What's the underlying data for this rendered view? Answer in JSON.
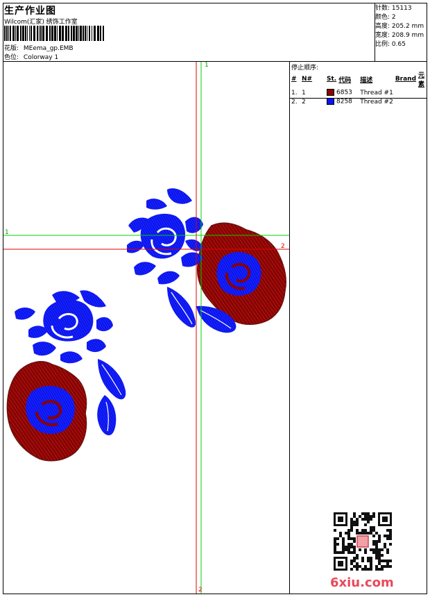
{
  "header": {
    "title": "生产作业图",
    "studio": "Wilcom(汇家) 绣饰工作室",
    "design_label": "花版:",
    "design_value": "MEema_gp.EMB",
    "colorway_label": "色位:",
    "colorway_value": "Colorway 1"
  },
  "stats": [
    {
      "label": "针数:",
      "value": "15113"
    },
    {
      "label": "颜色:",
      "value": "2"
    },
    {
      "label": "高度:",
      "value": "205.2 mm"
    },
    {
      "label": "宽度:",
      "value": "208.9 mm"
    },
    {
      "label": "比例:",
      "value": "0.65"
    }
  ],
  "thread_panel": {
    "stop_sequence_label": "停止顺序:",
    "columns": [
      "#",
      "N#",
      "St.",
      "代码",
      "描述",
      "Brand",
      "元素"
    ],
    "rows": [
      {
        "index": "1.",
        "needle": "1",
        "code": "6853",
        "description": "Thread #1",
        "color": "#8b0000"
      },
      {
        "index": "2.",
        "needle": "2",
        "code": "8258",
        "description": "Thread #2",
        "color": "#0a14f0"
      }
    ]
  },
  "axes": {
    "green_v_label": "1",
    "green_h_label": "1",
    "red_h_label": "2",
    "red_v_label": "2"
  },
  "colors": {
    "thread_red": "#8b0000",
    "thread_blue": "#0a14f0",
    "guide_green": "#00d000",
    "guide_red": "#e00000"
  },
  "watermark": "6xiu.com"
}
